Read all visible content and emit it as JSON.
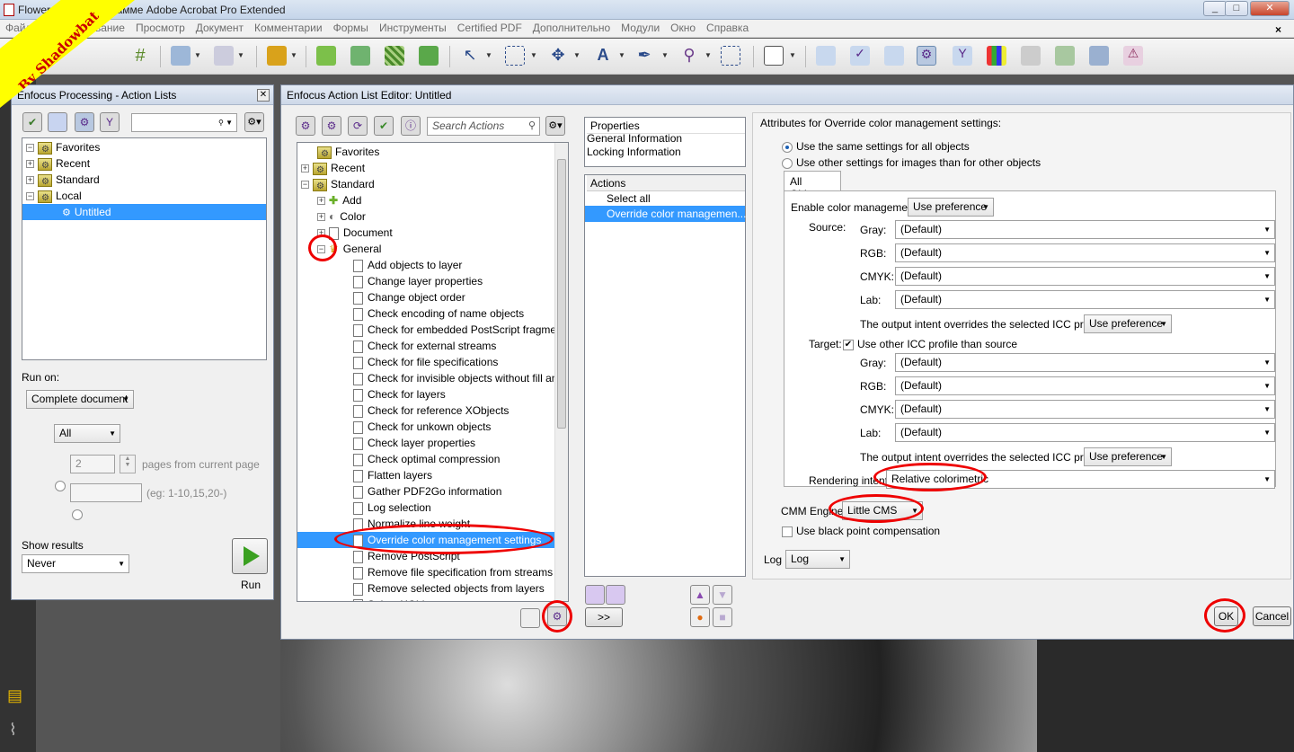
{
  "app": {
    "title": "Flower.pdf - О программе Adobe Acrobat Pro Extended",
    "watermark": "By Shadowbat"
  },
  "menu": [
    "Файл",
    "Редактирование",
    "Просмотр",
    "Документ",
    "Комментарии",
    "Формы",
    "Инструменты",
    "Certified PDF",
    "Дополнительно",
    "Модули",
    "Окно",
    "Справка"
  ],
  "menu_close": "×",
  "window_buttons": {
    "minimize": "_",
    "maximize": "□",
    "close": "✕"
  },
  "actionLists": {
    "title": "Enfocus Processing - Action Lists",
    "tree": [
      {
        "label": "Favorites",
        "exp": "−"
      },
      {
        "label": "Recent",
        "exp": "+"
      },
      {
        "label": "Standard",
        "exp": "+"
      },
      {
        "label": "Local",
        "exp": "−"
      },
      {
        "label": "Untitled",
        "exp": ""
      }
    ],
    "run_on_label": "Run on:",
    "run_on_value": "Complete document",
    "pages_value": "All",
    "pages_number": "2",
    "pages_from_label": "pages from current page",
    "range_hint": "(eg: 1-10,15,20-)",
    "show_results_label": "Show results",
    "show_results_value": "Never",
    "run_label": "Run"
  },
  "editor": {
    "title": "Enfocus Action List Editor: Untitled",
    "search_placeholder": "Search Actions",
    "tree_top": [
      {
        "label": "Favorites",
        "exp": ""
      },
      {
        "label": "Recent",
        "exp": "+"
      },
      {
        "label": "Standard",
        "exp": "−"
      },
      {
        "label": "Add",
        "exp": "+"
      },
      {
        "label": "Color",
        "exp": "+"
      },
      {
        "label": "Document",
        "exp": "+"
      },
      {
        "label": "General",
        "exp": "−"
      }
    ],
    "general_items": [
      "Add objects to layer",
      "Change layer properties",
      "Change object order",
      "Check encoding of name objects",
      "Check for embedded PostScript fragments",
      "Check for external streams",
      "Check for file specifications",
      "Check for invisible objects without fill an...",
      "Check for layers",
      "Check for reference XObjects",
      "Check for unkown objects",
      "Check layer properties",
      "Check optimal compression",
      "Flatten layers",
      "Gather PDF2Go information",
      "Log selection",
      "Normalize line weight",
      "Override color management settings",
      "Remove PostScript",
      "Remove file specification from streams",
      "Remove selected objects from layers",
      "Select XObjects"
    ],
    "properties": {
      "header": "Properties",
      "items": [
        "General Information",
        "Locking Information"
      ]
    },
    "actions": {
      "header": "Actions",
      "items": [
        "Select all",
        "Override color managemen..."
      ]
    },
    "move_button": ">>",
    "attrs": {
      "title": "Attributes for Override color management settings:",
      "radio_same": "Use the same settings for all objects",
      "radio_other": "Use other settings for images than for other objects",
      "tab": "All Objects",
      "enable_label": "Enable color management",
      "enable_value": "Use preference",
      "source_label": "Source:",
      "target_label": "Target:",
      "target_check": "Use other ICC profile than source",
      "channels": [
        "Gray:",
        "RGB:",
        "CMYK:",
        "Lab:"
      ],
      "default_value": "(Default)",
      "output_intent_label": "The output intent overrides the selected ICC profiles",
      "output_intent_value": "Use preference",
      "rendering_label": "Rendering intent:",
      "rendering_value": "Relative colorimetric",
      "cmm_label": "CMM Engine:",
      "cmm_value": "Little CMS",
      "bpc_label": "Use black point compensation",
      "log_label": "Log",
      "log_value": "Log"
    },
    "ok": "OK",
    "cancel": "Cancel"
  },
  "colors": {
    "accent": "#3399ff",
    "highlight": "#e00000"
  }
}
